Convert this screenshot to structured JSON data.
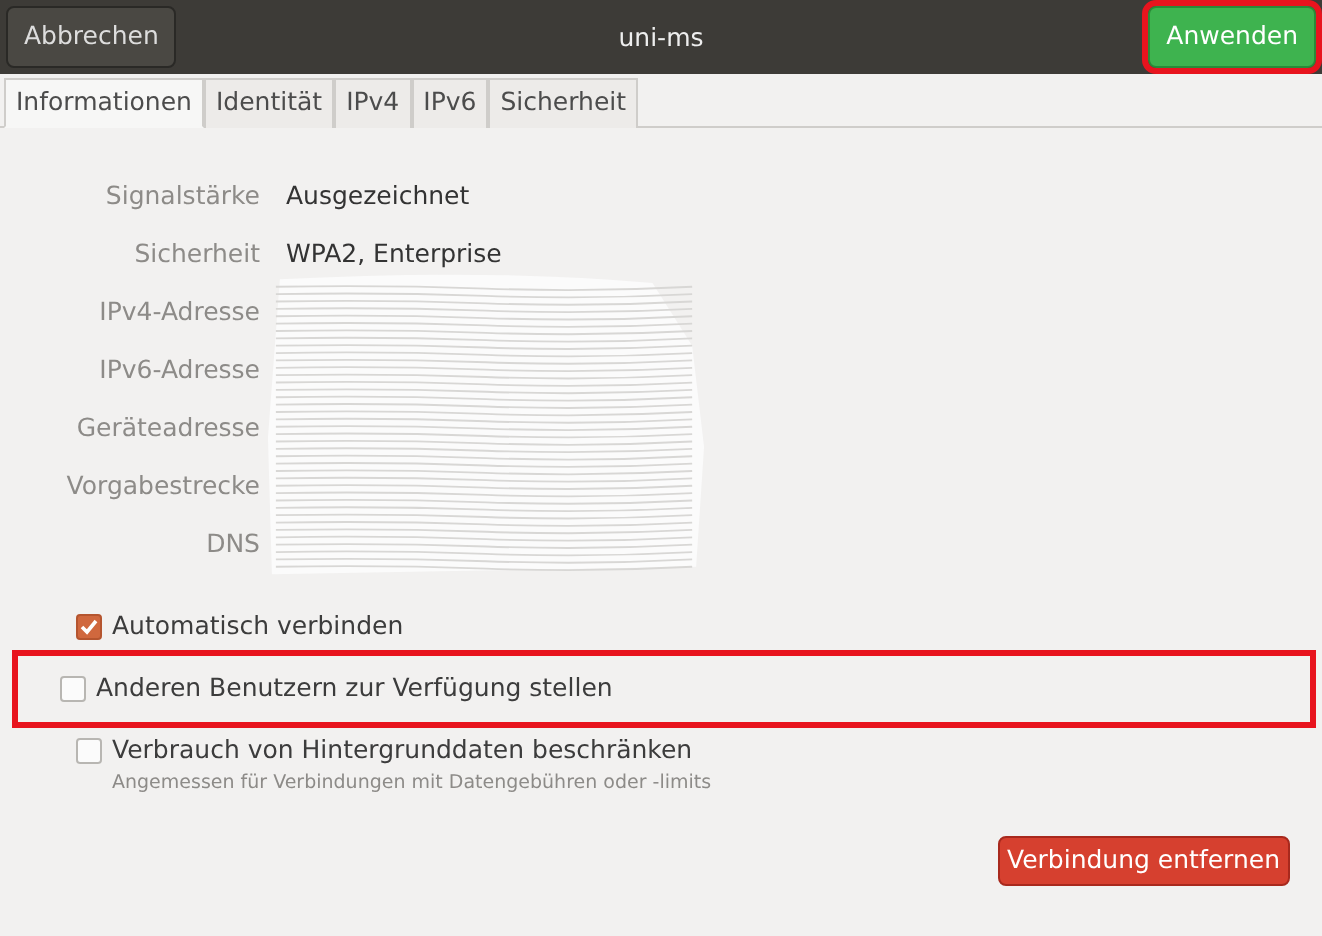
{
  "header": {
    "cancel": "Abbrechen",
    "title": "uni-ms",
    "apply": {
      "label": "Anwenden",
      "highlighted": true
    }
  },
  "tabs": [
    {
      "label": "Informationen",
      "selected": true
    },
    {
      "label": "Identität",
      "selected": false
    },
    {
      "label": "IPv4",
      "selected": false
    },
    {
      "label": "IPv6",
      "selected": false
    },
    {
      "label": "Sicherheit",
      "selected": false
    }
  ],
  "details": [
    {
      "label": "Signalstärke",
      "value": "Ausgezeichnet"
    },
    {
      "label": "Sicherheit",
      "value": "WPA2, Enterprise"
    },
    {
      "label": "IPv4-Adresse"
    },
    {
      "label": "IPv6-Adresse"
    },
    {
      "label": "Geräteadresse"
    },
    {
      "label": "Vorgabestrecke"
    },
    {
      "label": "DNS"
    }
  ],
  "options": [
    {
      "label": "Automatisch verbinden",
      "checked": true,
      "highlighted": false
    },
    {
      "label": "Anderen Benutzern zur Verfügung stellen",
      "checked": false,
      "highlighted": true
    },
    {
      "label": "Verbrauch von Hintergrunddaten beschränken",
      "hint": "Angemessen für Verbindungen mit Datengebühren oder -limits",
      "checked": false,
      "highlighted": false
    }
  ],
  "remove_button": "Verbindung entfernen"
}
